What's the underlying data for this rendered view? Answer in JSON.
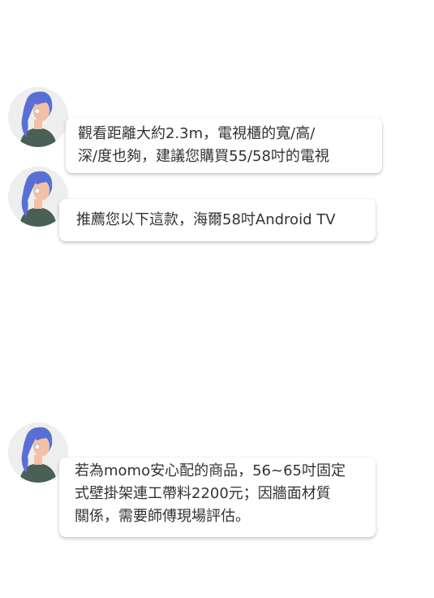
{
  "messages": [
    {
      "sender_avatar": "agent-avatar",
      "lines": [
        "觀看距離大約2.3m，電視櫃的寬/高/",
        "深/度也夠，建議您購買55/58吋的電視"
      ]
    },
    {
      "sender_avatar": "agent-avatar",
      "lines": [
        "推薦您以下這款，海爾58吋Android TV"
      ]
    },
    {
      "sender_avatar": "agent-avatar",
      "lines": [
        "若為momo安心配的商品，56~65吋固定",
        "式壁掛架連工帶料2200元；因牆面材質",
        "關係，需要師傅現場評估。"
      ]
    }
  ],
  "colors": {
    "background": "#ffffff",
    "bubble": "#ffffff",
    "text": "#333333",
    "avatar_bg": "#eeeeee",
    "hair": "#5a6fd6",
    "shirt": "#4a5f56",
    "skin": "#f2c1a3"
  }
}
